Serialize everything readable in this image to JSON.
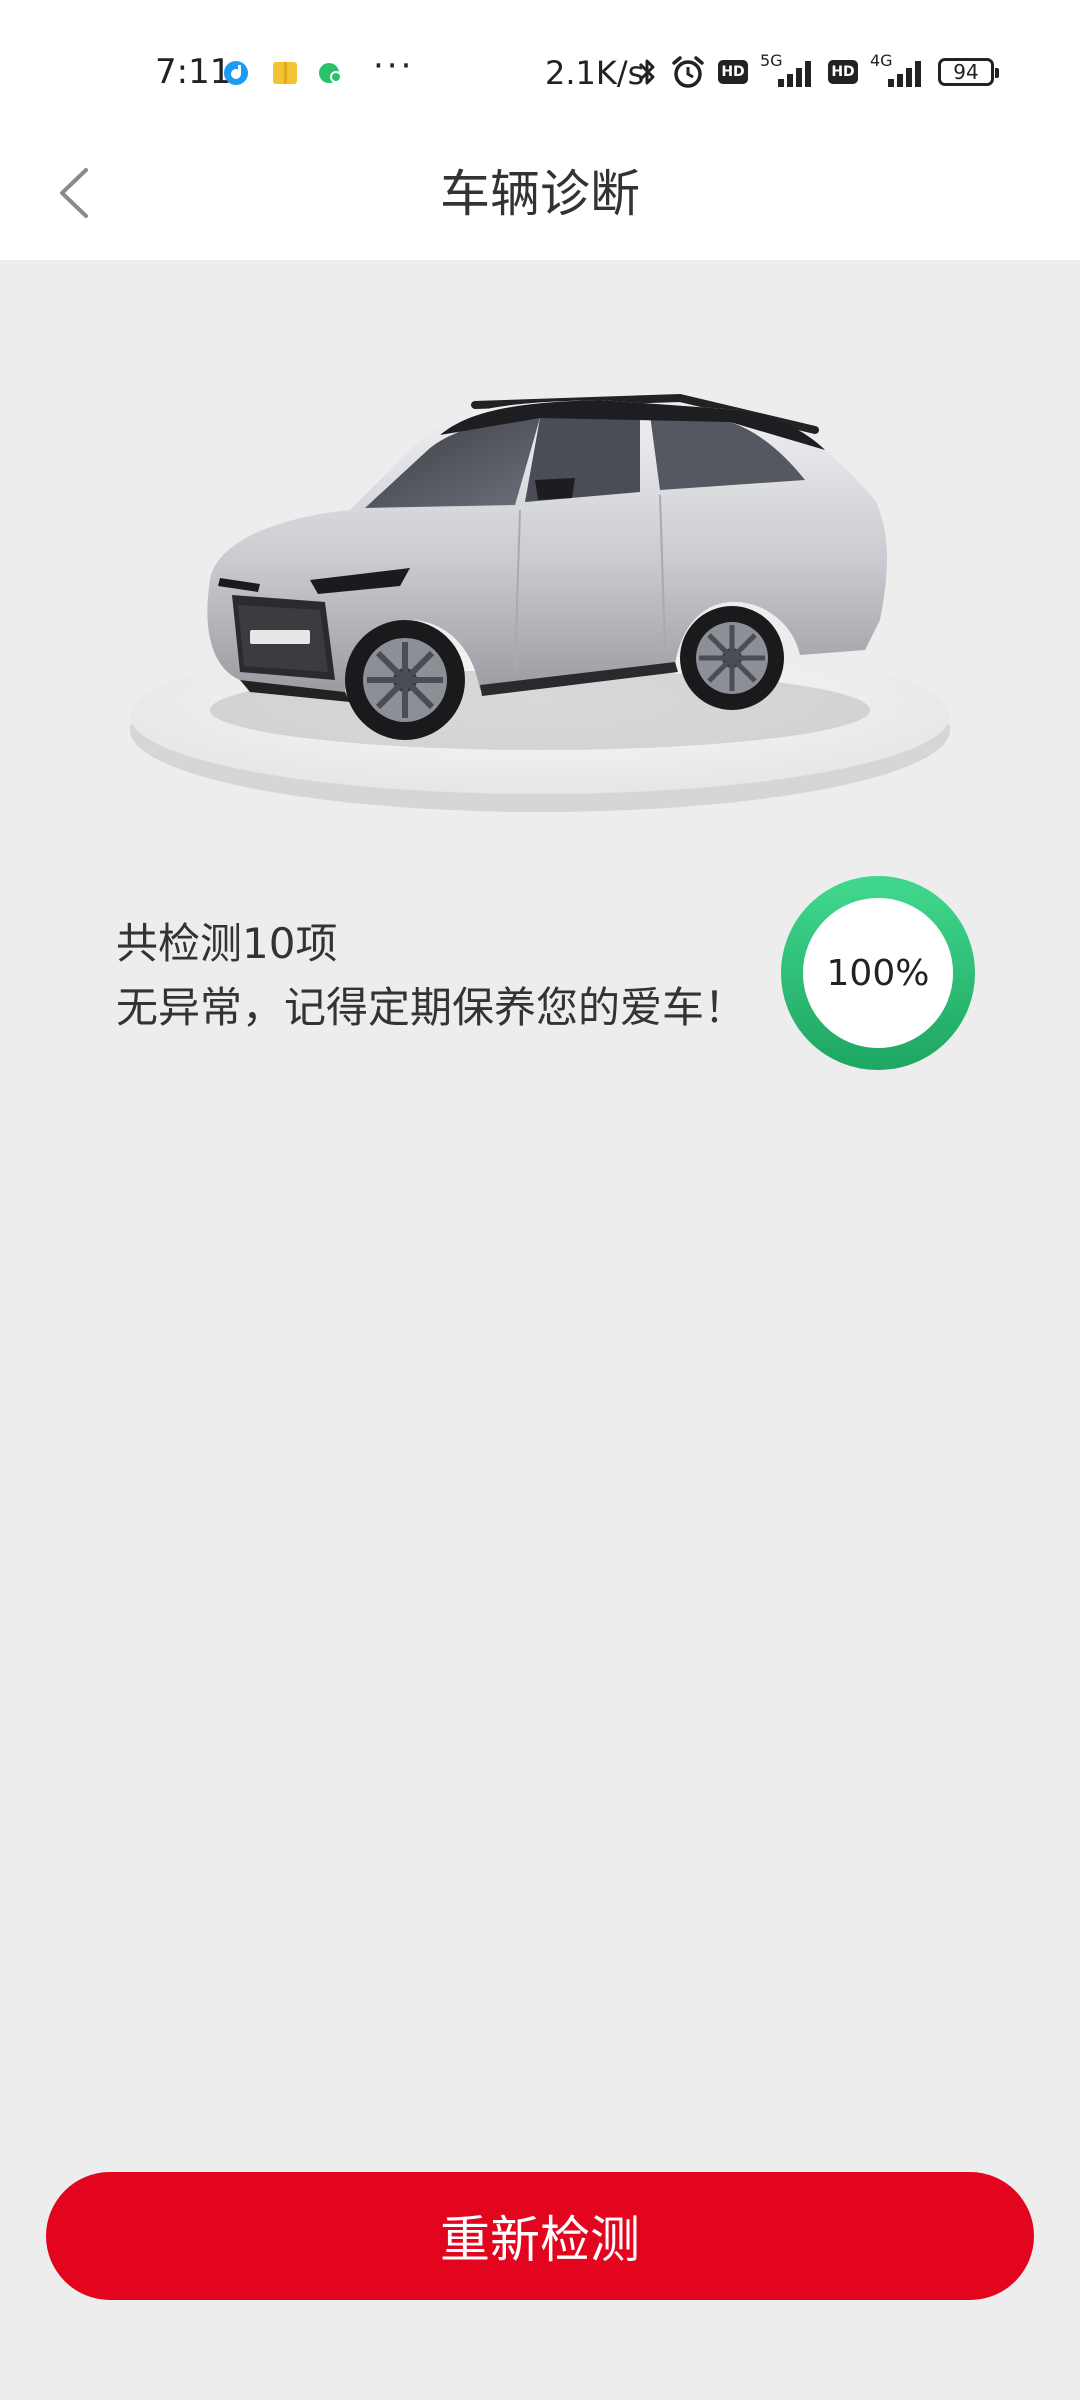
{
  "status_bar": {
    "time": "7:11",
    "more": "···",
    "net_speed": "2.1K/s",
    "hd1": "HD",
    "net1": "5G",
    "hd2": "HD",
    "net2": "4G",
    "battery": "94",
    "icons": [
      "app-notification-blue-icon",
      "app-notification-yellow-icon",
      "app-notification-green-icon",
      "bluetooth-icon",
      "alarm-icon"
    ]
  },
  "header": {
    "title": "车辆诊断",
    "back_icon": "chevron-left-icon"
  },
  "result": {
    "count_text": "共检测10项",
    "message": "无异常，记得定期保养您的爱车！",
    "progress_label": "100%",
    "progress_value": 1.0
  },
  "actions": {
    "recheck_label": "重新检测"
  },
  "colors": {
    "accent_red": "#e3051e",
    "ring_green_start": "#1fa864",
    "ring_green_end": "#3fd68c",
    "background": "#ededed"
  }
}
